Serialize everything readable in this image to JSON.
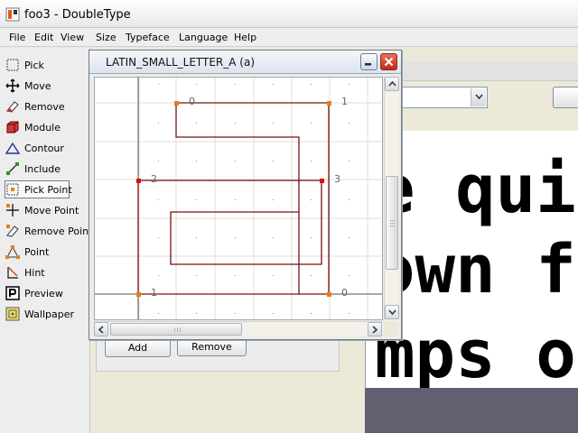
{
  "window": {
    "title": "foo3 - DoubleType"
  },
  "menu": [
    "File",
    "Edit",
    "View",
    "Size",
    "Typeface",
    "Language",
    "Help"
  ],
  "tools": [
    {
      "label": "Pick",
      "icon": "pick-icon"
    },
    {
      "label": "Move",
      "icon": "move-arrows-icon"
    },
    {
      "label": "Remove",
      "icon": "eraser-icon"
    },
    {
      "label": "Module",
      "icon": "cube-icon"
    },
    {
      "label": "Contour",
      "icon": "triangle-icon"
    },
    {
      "label": "Include",
      "icon": "include-icon"
    },
    {
      "label": "Pick Point",
      "icon": "pick-point-icon",
      "selected": true
    },
    {
      "label": "Move Point",
      "icon": "move-point-icon"
    },
    {
      "label": "Remove Point",
      "icon": "remove-point-icon"
    },
    {
      "label": "Point",
      "icon": "point-icon"
    },
    {
      "label": "Hint",
      "icon": "hint-icon"
    },
    {
      "label": "Preview",
      "icon": "preview-icon"
    },
    {
      "label": "Wallpaper",
      "icon": "wallpaper-icon"
    }
  ],
  "buttons": {
    "add": "Add",
    "remove": "Remove"
  },
  "preview": {
    "lines": [
      "e quic",
      "own fo",
      "mps ov"
    ]
  },
  "glyph_editor": {
    "title": "LATIN_SMALL_LETTER_A (a)",
    "point_labels": [
      "0",
      "1",
      "2",
      "3",
      "1",
      "0"
    ]
  },
  "colors": {
    "outline": "#7a1010",
    "point_on": "#e87c1a",
    "point_selected": "#e01010",
    "grid": "#dcdcdc"
  }
}
